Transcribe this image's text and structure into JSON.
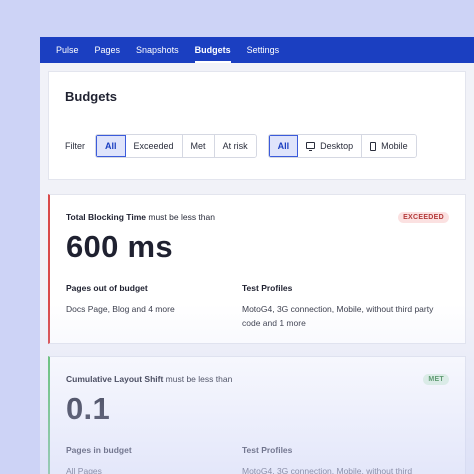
{
  "nav": {
    "tabs": [
      {
        "label": "Pulse"
      },
      {
        "label": "Pages"
      },
      {
        "label": "Snapshots"
      },
      {
        "label": "Budgets",
        "active": true
      },
      {
        "label": "Settings"
      }
    ]
  },
  "page": {
    "title": "Budgets",
    "filter_label": "Filter",
    "status_filters": [
      "All",
      "Exceeded",
      "Met",
      "At risk"
    ],
    "device_filters": [
      "All",
      "Desktop",
      "Mobile"
    ]
  },
  "budgets": [
    {
      "metric": "Total Blocking Time",
      "condition": "must be less than",
      "value": "600 ms",
      "status": "EXCEEDED",
      "pages_title": "Pages out of budget",
      "pages_text": "Docs Page, Blog and 4 more",
      "profiles_title": "Test Profiles",
      "profiles_text": "MotoG4, 3G connection, Mobile, without third party code and 1 more"
    },
    {
      "metric": "Cumulative Layout Shift",
      "condition": "must be less than",
      "value": "0.1",
      "status": "MET",
      "pages_title": "Pages in budget",
      "pages_text": "All Pages",
      "profiles_title": "Test Profiles",
      "profiles_text": "MotoG4, 3G connection, Mobile, without third"
    }
  ],
  "colors": {
    "nav_bg": "#1b3fc1",
    "exceeded": "#d94a4a",
    "met": "#5bbf6a",
    "background": "#cdd3f6"
  }
}
